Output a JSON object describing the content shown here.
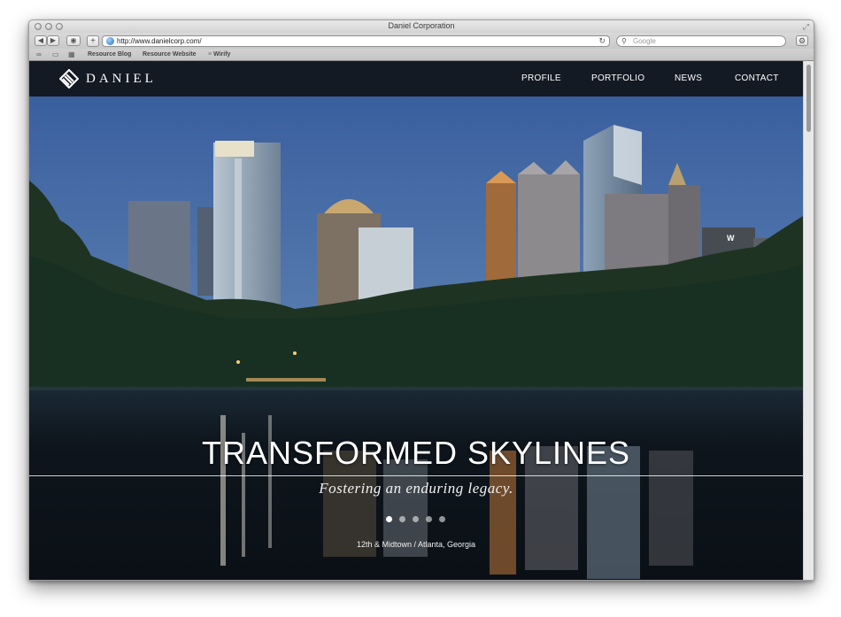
{
  "window": {
    "title": "Daniel Corporation"
  },
  "toolbar": {
    "url": "http://www.danielcorp.com/",
    "search_placeholder": "Google"
  },
  "bookmarks": [
    {
      "label": "Resource Blog"
    },
    {
      "label": "Resource Website"
    },
    {
      "label": "Wirify"
    }
  ],
  "site": {
    "logo_text": "DANIEL",
    "nav": [
      {
        "label": "PROFILE"
      },
      {
        "label": "PORTFOLIO"
      },
      {
        "label": "NEWS"
      },
      {
        "label": "CONTACT"
      }
    ]
  },
  "hero": {
    "title": "TRANSFORMED SKYLINES",
    "subtitle": "Fostering an enduring legacy.",
    "caption": "12th & Midtown / Atlanta, Georgia",
    "slides_count": 5,
    "active_slide": 1
  },
  "colors": {
    "nav_bg": "#141a24",
    "sky_top": "#3a5f9e",
    "sky_bottom": "#5d7fb3",
    "water": "#0e151c"
  },
  "icons": [
    "back-icon",
    "forward-icon",
    "share-icon",
    "plus-icon",
    "globe-icon",
    "reload-icon",
    "search-icon",
    "gear-icon",
    "reading-list-icon",
    "bookmarks-icon",
    "top-sites-icon",
    "logo-icon",
    "resize-icon"
  ]
}
